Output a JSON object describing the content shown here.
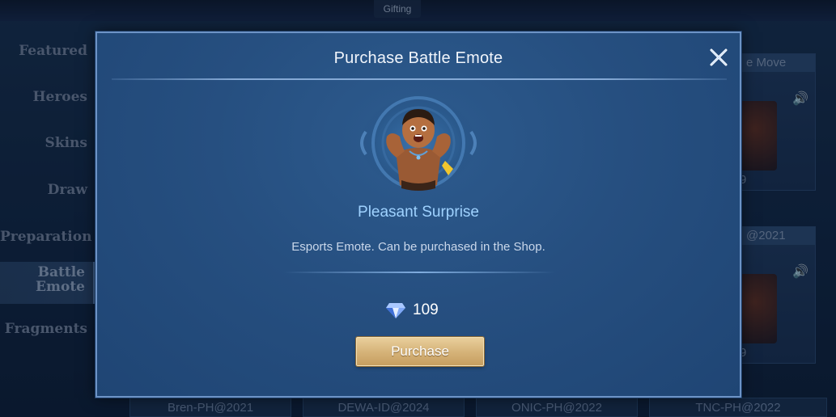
{
  "background": {
    "gifting_tab": "Gifting",
    "sidebar": [
      {
        "label": "Featured",
        "active": false
      },
      {
        "label": "Heroes",
        "active": false
      },
      {
        "label": "Skins",
        "active": false
      },
      {
        "label": "Draw",
        "active": false
      },
      {
        "label": "Preparation",
        "active": false
      },
      {
        "label": "Battle\nEmote",
        "active": true
      },
      {
        "label": "Fragments",
        "active": false
      }
    ],
    "right_cards": [
      {
        "header": "e Move",
        "price": "9"
      },
      {
        "header": "@2021",
        "price": "9"
      }
    ],
    "bottom_tabs": [
      "Bren-PH@2021",
      "DEWA-ID@2024",
      "ONIC-PH@2022",
      "TNC-PH@2022"
    ]
  },
  "modal": {
    "title": "Purchase Battle Emote",
    "emote_name": "Pleasant Surprise",
    "description": "Esports Emote. Can be purchased in the Shop.",
    "price": "109",
    "currency_icon": "diamond-icon",
    "purchase_label": "Purchase",
    "close_icon": "close-icon"
  },
  "colors": {
    "modal_bg": "#264f80",
    "modal_border": "#6d93c6",
    "emote_name": "#9fd2ff",
    "purchase_button": "#d6b47a"
  }
}
